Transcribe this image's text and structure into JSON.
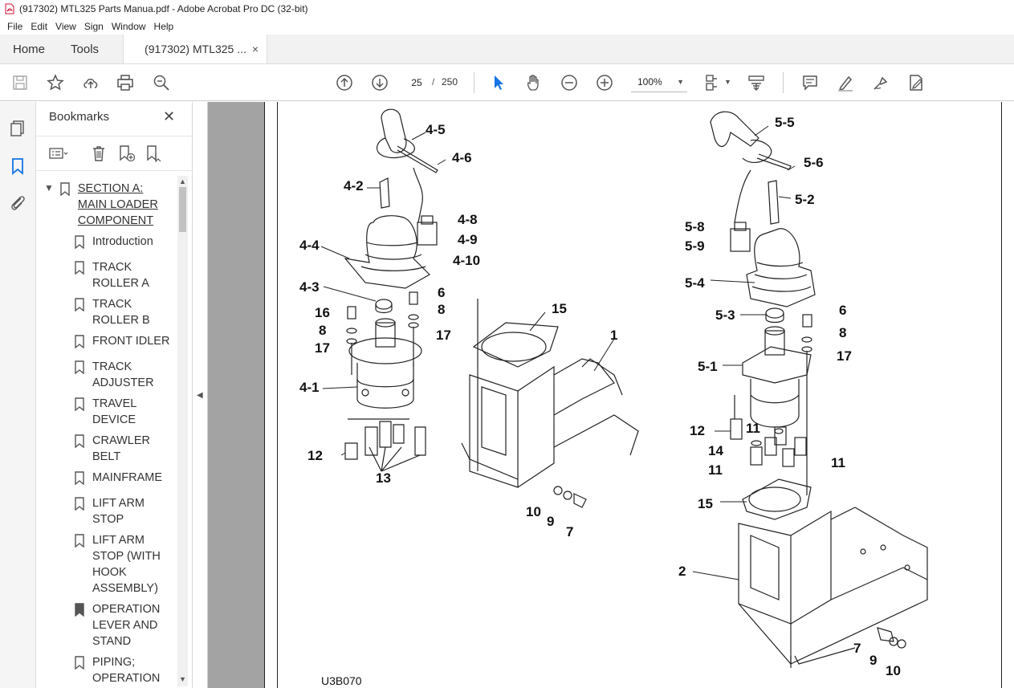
{
  "window": {
    "title": "(917302) MTL325 Parts Manua.pdf - Adobe Acrobat Pro DC (32-bit)"
  },
  "menu": [
    "File",
    "Edit",
    "View",
    "Sign",
    "Window",
    "Help"
  ],
  "tabs": {
    "home": "Home",
    "tools": "Tools",
    "doc": "(917302) MTL325 ...",
    "close": "×"
  },
  "toolbar": {
    "page_current": "25",
    "page_sep": "/",
    "page_total": "250",
    "zoom": "100%"
  },
  "bookmarks": {
    "title": "Bookmarks",
    "items": [
      {
        "label": "SECTION A: MAIN LOADER COMPONENT",
        "lines": [
          "SECTION A:",
          "MAIN LOADER",
          "COMPONENT"
        ],
        "expanded": true
      },
      {
        "label": "Introduction",
        "lines": [
          "Introduction"
        ]
      },
      {
        "label": "TRACK ROLLER A",
        "lines": [
          "TRACK",
          "ROLLER A"
        ]
      },
      {
        "label": "TRACK ROLLER B",
        "lines": [
          "TRACK",
          "ROLLER B"
        ]
      },
      {
        "label": "FRONT IDLER",
        "lines": [
          "FRONT IDLER"
        ]
      },
      {
        "label": "TRACK ADJUSTER",
        "lines": [
          "TRACK",
          "ADJUSTER"
        ]
      },
      {
        "label": "TRAVEL DEVICE",
        "lines": [
          "TRAVEL",
          "DEVICE"
        ]
      },
      {
        "label": "CRAWLER BELT",
        "lines": [
          "CRAWLER",
          "BELT"
        ]
      },
      {
        "label": "MAINFRAME",
        "lines": [
          "MAINFRAME"
        ]
      },
      {
        "label": "LIFT ARM STOP",
        "lines": [
          "LIFT ARM",
          "STOP"
        ]
      },
      {
        "label": "LIFT ARM STOP (WITH HOOK ASSEMBLY)",
        "lines": [
          "LIFT ARM",
          "STOP (WITH",
          "HOOK",
          "ASSEMBLY)"
        ]
      },
      {
        "label": "OPERATION LEVER AND STAND",
        "lines": [
          "OPERATION",
          "LEVER AND",
          "STAND"
        ]
      },
      {
        "label": "PIPING; OPERATION",
        "lines": [
          "PIPING;",
          "OPERATION"
        ]
      }
    ]
  },
  "diagram": {
    "figure_code": "U3B070",
    "left_labels": [
      "4-5",
      "4-6",
      "4-2",
      "4-8",
      "4-9",
      "4-10",
      "4-4",
      "4-3",
      "6",
      "16",
      "8",
      "17",
      "8",
      "17",
      "15",
      "1",
      "4-1",
      "12",
      "13",
      "10",
      "9",
      "7"
    ],
    "right_labels": [
      "5-5",
      "5-6",
      "5-2",
      "5-8",
      "5-9",
      "5-4",
      "5-3",
      "6",
      "8",
      "17",
      "5-1",
      "12",
      "11",
      "14",
      "11",
      "11",
      "15",
      "2",
      "7",
      "9",
      "10"
    ]
  }
}
